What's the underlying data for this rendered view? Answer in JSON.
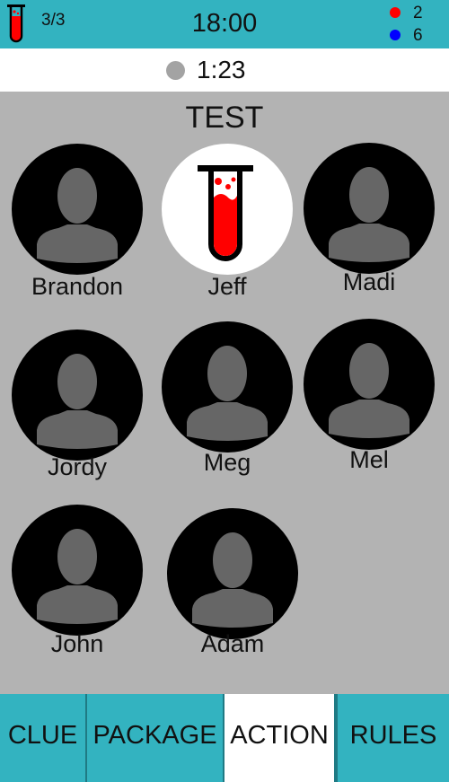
{
  "header": {
    "test_count": "3/3",
    "clock": "18:00",
    "scores": [
      {
        "color": "#ff0000",
        "value": "2"
      },
      {
        "color": "#0000ff",
        "value": "6"
      }
    ]
  },
  "timer": {
    "value": "1:23"
  },
  "panel": {
    "title": "TEST"
  },
  "players": [
    {
      "name": "Brandon",
      "selected": false
    },
    {
      "name": "Jeff",
      "selected": true
    },
    {
      "name": "Madi",
      "selected": false
    },
    {
      "name": "Jordy",
      "selected": false
    },
    {
      "name": "Meg",
      "selected": false
    },
    {
      "name": "Mel",
      "selected": false
    },
    {
      "name": "John",
      "selected": false
    },
    {
      "name": "Adam",
      "selected": false
    }
  ],
  "tabs": [
    {
      "label": "CLUE",
      "active": false
    },
    {
      "label": "PACKAGE",
      "active": false
    },
    {
      "label": "ACTION",
      "active": true
    },
    {
      "label": "RULES",
      "active": false
    }
  ],
  "colors": {
    "accent": "#33b3c0",
    "panel": "#b3b3b3",
    "tube_liquid": "#ff0000",
    "avatar_bg": "#000000",
    "avatar_silhouette": "#666666"
  },
  "icons": {
    "player": "person-silhouette-icon",
    "selected_player": "test-tube-icon",
    "header": "test-tube-icon",
    "timer": "timer-dot-icon"
  }
}
